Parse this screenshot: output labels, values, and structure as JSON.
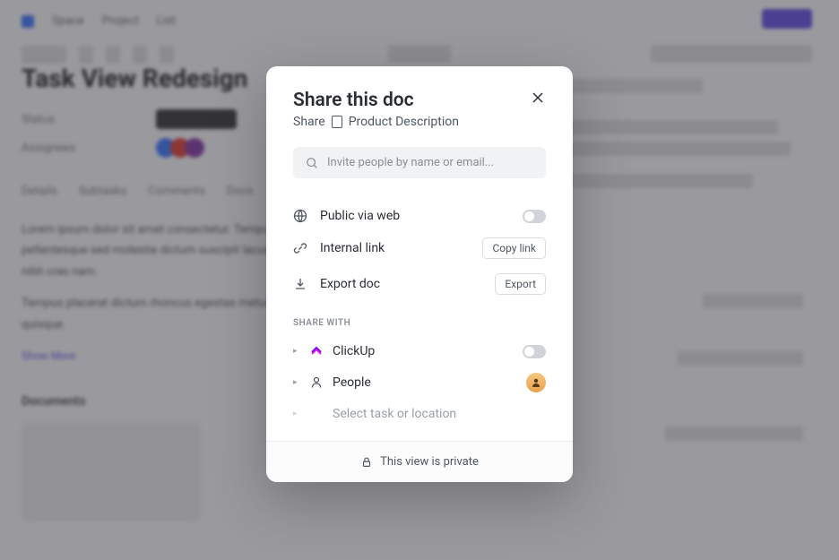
{
  "background": {
    "page_title": "Task View Redesign",
    "breadcrumbs": [
      "Space",
      "Project",
      "List"
    ],
    "meta": {
      "status_label": "Status",
      "assignees_label": "Assignees"
    },
    "tabs": [
      "Details",
      "Subtasks",
      "Comments",
      "Docs"
    ],
    "show_more": "Show More",
    "subheading": "Documents"
  },
  "modal": {
    "title": "Share this doc",
    "subtitle_prefix": "Share",
    "doc_name": "Product Description",
    "search_placeholder": "Invite people by name or email...",
    "options": {
      "public": {
        "label": "Public via web"
      },
      "internal": {
        "label": "Internal link",
        "button": "Copy link"
      },
      "export": {
        "label": "Export doc",
        "button": "Export"
      }
    },
    "share_with_label": "SHARE WITH",
    "share_rows": {
      "clickup": {
        "label": "ClickUp"
      },
      "people": {
        "label": "People"
      },
      "select": {
        "label": "Select task or location"
      }
    },
    "footer": "This view is private"
  }
}
